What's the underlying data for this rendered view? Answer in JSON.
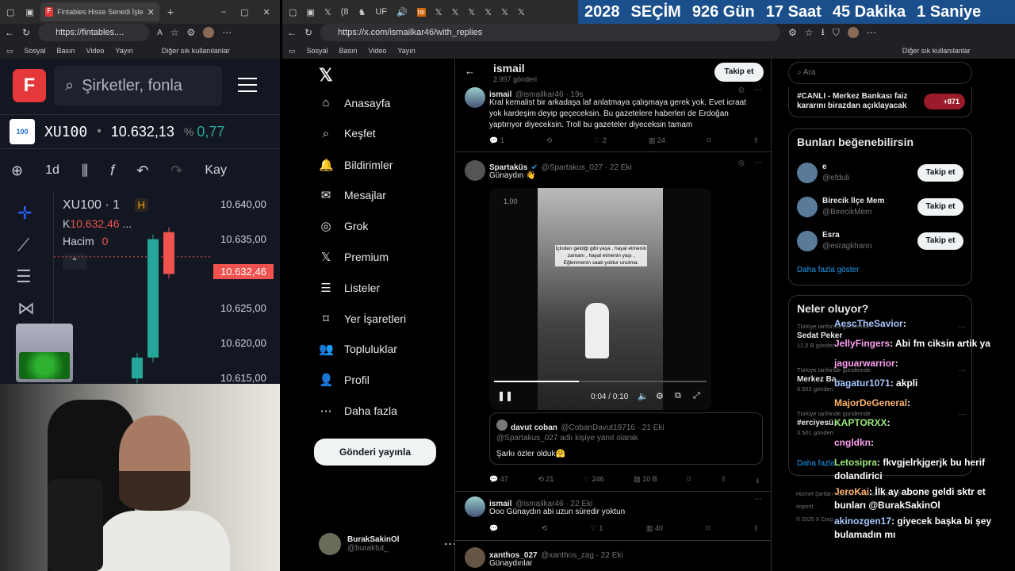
{
  "left": {
    "tab_title": "Fintables Hisse Senedi İşlem El",
    "url": "https://fintables....",
    "bookmarks": [
      "Sosyal",
      "Basın",
      "Video",
      "Yayın"
    ],
    "bookmarks_other": "Diğer sık kullanılanlar",
    "search_placeholder": "Şirketler, fonla",
    "symbol": "XU100",
    "price": "10.632,13",
    "pct_sign": "%",
    "pct": "0,77",
    "interval": "1d",
    "toolbar_extra": "Kay",
    "chart_title": "XU100 · 1",
    "h_badge": "H",
    "k_label": "K",
    "k_value": "10.632,46",
    "k_more": "...",
    "volume_label": "Hacim",
    "volume_value": "0",
    "price_ticks": [
      "10.640,00",
      "10.635,00",
      "10.630,00",
      "10.625,00",
      "10.620,00",
      "10.615,00"
    ],
    "current_price": "10.632,46",
    "candles": [
      {
        "o": 10615,
        "c": 10618,
        "dir": "up"
      },
      {
        "o": 10618,
        "c": 10635,
        "dir": "up"
      },
      {
        "o": 10636,
        "c": 10630,
        "dir": "down"
      }
    ]
  },
  "right": {
    "tabs_hint": [
      "(8",
      "UF",
      "hb",
      "Dj"
    ],
    "banner": {
      "year": "2028",
      "secim": "SEÇİM",
      "days": "926 Gün",
      "hours": "17 Saat",
      "minutes": "45 Dakika",
      "seconds": "1 Saniye"
    },
    "url": "https://x.com/ismailkar46/with_replies",
    "bookmarks": [
      "Sosyal",
      "Basın",
      "Video",
      "Yayın"
    ],
    "bookmarks_other": "Diğer sık kullanılanlar"
  },
  "x": {
    "nav": [
      "Anasayfa",
      "Keşfet",
      "Bildirimler",
      "Mesajlar",
      "Grok",
      "Premium",
      "Listeler",
      "Yer İşaretleri",
      "Topluluklar",
      "Profil",
      "Daha fazla"
    ],
    "post_button": "Gönderi yayınla",
    "user_name": "BurakSakinOl",
    "user_handle": "@buraktut_",
    "profile_name": "ismail",
    "profile_posts": "2.997 gönderi",
    "follow": "Takip et",
    "tweets": [
      {
        "name": "ismail",
        "handle": "@ismailkar46 · 19s",
        "text": "Kral kemalist bir arkadaşa laf anlatmaya çalışmaya gerek yok. Evet icraat yok kardeşim deyip geçeceksin. Bu gazetelere haberleri de Erdoğan yaptırıyor diyeceksin. Troll bu gazeteler diyeceksin tamam",
        "replies": "1",
        "likes": "2",
        "views": "24"
      },
      {
        "name": "Spartaküs",
        "handle": "@Spartakus_027 · 22 Eki",
        "text": "Günaydın 👋",
        "video_time": "0:04 / 0:10",
        "video_text": "İçinden geldiği gibi yaşa , hayal etmenin zamanı , hayal etmenin yaşı , Eğlenmenin saati yoktur unutma.",
        "video_speed": "1.00",
        "quote_name": "davut coban",
        "quote_handle": "@CobanDavut19716 · 21 Eki",
        "quote_reply": "@Spartakus_027 adlı kişiye yanıt olarak",
        "quote_text": "Şarkı özler olduk🤗",
        "replies": "47",
        "retweets": "21",
        "likes": "246",
        "views": "10 B"
      },
      {
        "name": "ismail",
        "handle": "@ismailkar46 · 22 Eki",
        "text": "Ooo Günaydın abi uzun süredir yoktun",
        "likes": "1",
        "views": "40"
      },
      {
        "name": "xanthos_027",
        "handle": "@xanthos_zag · 22 Eki",
        "text": "Günaydınlar"
      }
    ],
    "search_placeholder": "Ara",
    "banner_tweet": "#CANLI - Merkez Bankası faiz kararını birazdan açıklayacak",
    "banner_badge": "+871",
    "suggest_title": "Bunları beğenebilirsin",
    "suggestions": [
      {
        "name": "e",
        "handle": "@efduli"
      },
      {
        "name": "Birecik İlçe Mem",
        "handle": "@BirecikMem"
      },
      {
        "name": "Esra",
        "handle": "@esragkhann"
      }
    ],
    "show_more": "Daha fazla göster",
    "trends_title": "Neler oluyor?",
    "trends": [
      {
        "ctx": "Türkiye tarihinde gündemde",
        "name": "Sedat Peker",
        "count": "12,5 B gönderi"
      },
      {
        "ctx": "Türkiye tarihinde gündemde",
        "name": "Merkez Ba...",
        "count": "6.552 gönderi"
      },
      {
        "ctx": "Türkiye tarihinde gündemde",
        "name": "#erciyesü...",
        "count": "3.501 gönderi"
      }
    ],
    "trends_more": "Daha fazla...",
    "footer": [
      "Hizmet Şartları",
      "Gizlilik Politikası",
      "Çerez Politikası",
      "Imprint",
      "© 2025 X Corp."
    ]
  },
  "chat": [
    {
      "user": "AescTheSavior",
      "msg": "",
      "color": "#a7c7ff"
    },
    {
      "user": "JellyFingers",
      "msg": "Abi fm ciksin artik ya",
      "color": "#ff9ef0"
    },
    {
      "user": "jaguarwarrior",
      "msg": "",
      "color": "#ff9ef0"
    },
    {
      "user": "bagatur1071",
      "msg": "akpli",
      "color": "#a7c7ff"
    },
    {
      "user": "MajorDeGeneral",
      "msg": "",
      "color": "#ffb36b"
    },
    {
      "user": "KAPTORXX",
      "msg": "",
      "color": "#9ae87a"
    },
    {
      "user": "cngldkn",
      "msg": "",
      "color": "#ff9ef0"
    },
    {
      "user": "Letosipra",
      "msg": "fkvgjelrkjgerjk bu herif dolandirici",
      "color": "#9ae87a"
    },
    {
      "user": "JeroKai",
      "msg": "İlk ay abone geldi sktr et bunları @BurakSakinOl",
      "color": "#ffb36b"
    },
    {
      "user": "akinozgen17",
      "msg": "giyecek başka bi şey bulamadın mı",
      "color": "#a7c7ff"
    }
  ]
}
